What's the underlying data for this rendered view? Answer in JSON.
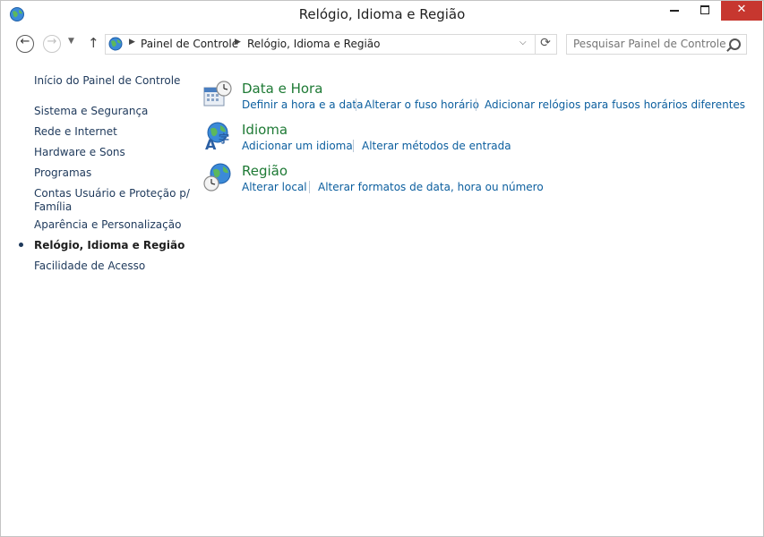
{
  "window": {
    "title": "Relógio, Idioma e Região",
    "close_glyph": "✕"
  },
  "nav": {
    "back_glyph": "←",
    "forward_glyph": "→",
    "recent_glyph": "▼",
    "up_glyph": "↑",
    "refresh_glyph": "⟳",
    "dropdown_glyph": "⌵"
  },
  "address": {
    "separator": "▶",
    "crumbs": [
      "Painel de Controle",
      "Relógio, Idioma e Região"
    ]
  },
  "search": {
    "placeholder": "Pesquisar Painel de Controle"
  },
  "sidebar": {
    "items": [
      {
        "label": "Início do Painel de Controle"
      },
      {
        "label": "Sistema e Segurança"
      },
      {
        "label": "Rede e Internet"
      },
      {
        "label": "Hardware e Sons"
      },
      {
        "label": "Programas"
      },
      {
        "label": "Contas Usuário e Proteção p/",
        "label2": "Família"
      },
      {
        "label": "Aparência e Personalização"
      },
      {
        "label": "Relógio, Idioma e Região",
        "active": true
      },
      {
        "label": "Facilidade de Acesso"
      }
    ]
  },
  "categories": [
    {
      "title": "Data e Hora",
      "icon": "calendar-clock-icon",
      "links": [
        "Definir a hora e a data",
        "Alterar o fuso horário",
        "Adicionar relógios para fusos horários diferentes"
      ]
    },
    {
      "title": "Idioma",
      "icon": "globe-language-icon",
      "links": [
        "Adicionar um idioma",
        "Alterar métodos de entrada"
      ]
    },
    {
      "title": "Região",
      "icon": "globe-clock-icon",
      "links": [
        "Alterar local",
        "Alterar formatos de data, hora ou número"
      ]
    }
  ],
  "colors": {
    "category_title": "#1e7a35",
    "link": "#0b5e9e",
    "sidebar_link": "#1e395b",
    "close_button": "#c7372f"
  }
}
